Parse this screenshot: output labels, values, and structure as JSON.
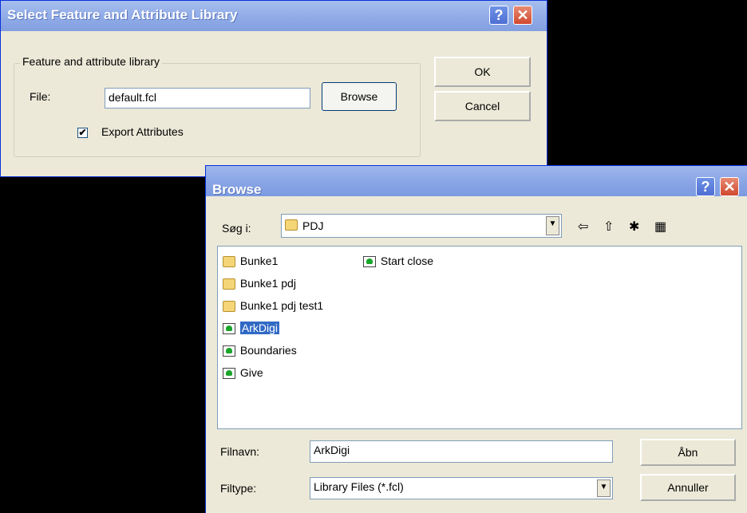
{
  "dialog1": {
    "title": "Select Feature and Attribute Library",
    "group_label": "Feature and attribute library",
    "file_label": "File:",
    "file_value": "default.fcl",
    "browse_label": "Browse",
    "export_label": "Export Attributes",
    "export_checked": true,
    "ok_label": "OK",
    "cancel_label": "Cancel"
  },
  "dialog2": {
    "title": "Browse",
    "lookin_label": "Søg i:",
    "lookin_value": "PDJ",
    "items": [
      {
        "name": "Bunke1",
        "type": "folder"
      },
      {
        "name": "Bunke1 pdj",
        "type": "folder"
      },
      {
        "name": "Bunke1 pdj test1",
        "type": "folder"
      },
      {
        "name": "ArkDigi",
        "type": "file",
        "selected": true
      },
      {
        "name": "Boundaries",
        "type": "file"
      },
      {
        "name": "Give",
        "type": "file"
      },
      {
        "name": "Start close",
        "type": "file"
      }
    ],
    "filename_label": "Filnavn:",
    "filename_value": "ArkDigi",
    "filetype_label": "Filtype:",
    "filetype_value": "Library Files (*.fcl)",
    "open_label": "Åbn",
    "cancel_label": "Annuller"
  },
  "icons": {
    "help": "?",
    "close": "✕",
    "back": "⇦",
    "up": "⇧",
    "newfolder": "✱",
    "views": "▦",
    "check": "✔",
    "dropdown": "▼"
  }
}
